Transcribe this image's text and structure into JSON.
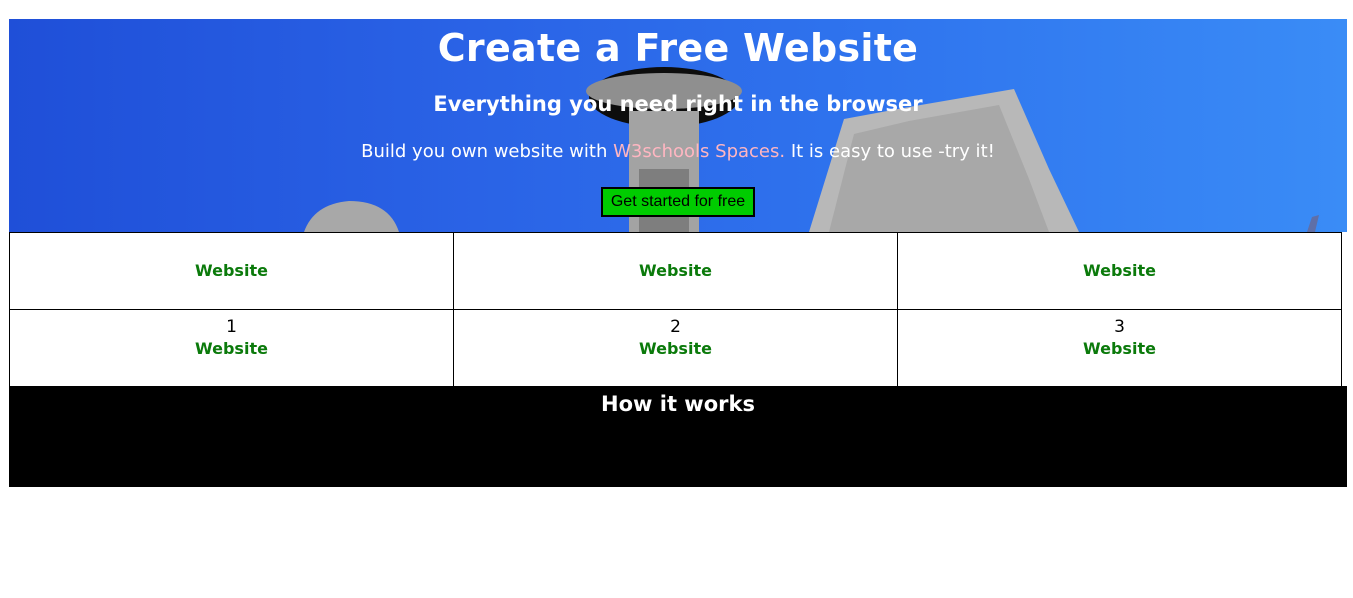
{
  "hero": {
    "title": "Create a Free Website",
    "subtitle": "Everything you need right in the browser",
    "text_before": "Build you own website with ",
    "brand": "W3schools Spaces.",
    "text_after": " It is easy to use -try it!",
    "cta_label": "Get started for free"
  },
  "grid": {
    "row1": [
      {
        "link": "Website"
      },
      {
        "link": "Website"
      },
      {
        "link": "Website"
      }
    ],
    "row2": [
      {
        "num": "1",
        "link": "Website"
      },
      {
        "num": "2",
        "link": "Website"
      },
      {
        "num": "3",
        "link": "Website"
      }
    ]
  },
  "how": {
    "title": "How it works"
  },
  "colors": {
    "cta": "#00cc00",
    "link": "#0b7a0b",
    "brand": "#ffb6c1",
    "sky": "#2a63e6"
  }
}
